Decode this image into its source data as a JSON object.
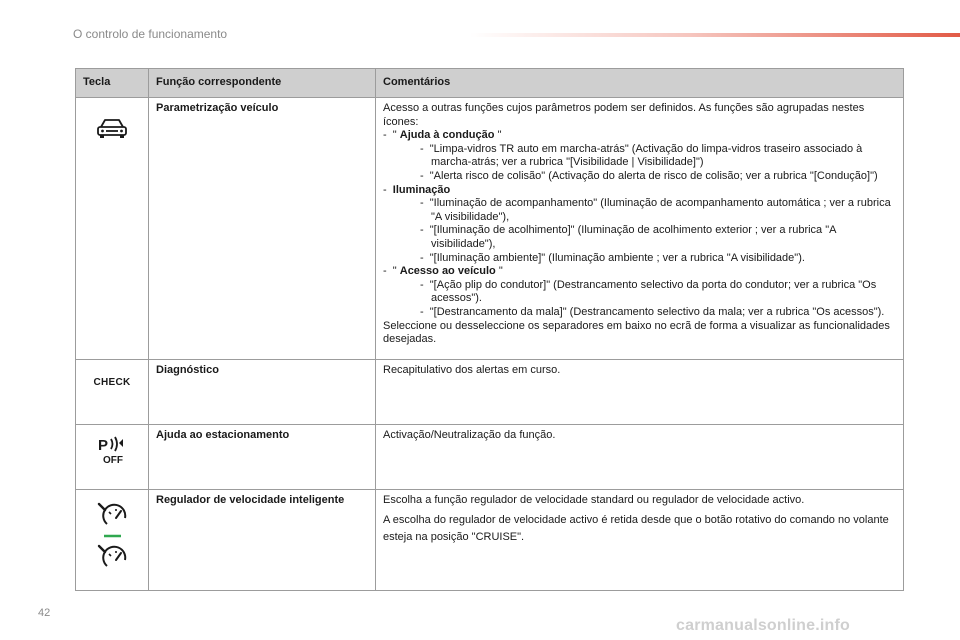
{
  "header": {
    "title": "O controlo de funcionamento"
  },
  "table": {
    "headers": {
      "key": "Tecla",
      "function": "Função correspondente",
      "comments": "Comentários"
    },
    "rows": {
      "vehicle": {
        "icon": "car-icon",
        "function": "Parametrização veículo",
        "intro": "Acesso a outras funções cujos parâmetros podem ser definidos. As funções são agrupadas nestes ícones:",
        "g1_prefix": "\"",
        "g1_title": "Ajuda à condução",
        "g1_suffix": "\"",
        "g1_items": [
          "\"Limpa-vidros TR auto em marcha-atrás\" (Activação do limpa-vidros traseiro associado à marcha-atrás; ver a rubrica \"[Visibilidade | Visibilidade]\")",
          "\"Alerta risco de colisão\" (Activação do alerta de risco de colisão; ver a rubrica \"[Condução]\")"
        ],
        "g2_title": "Iluminação",
        "g2_items": [
          "\"Iluminação de acompanhamento\" (Iluminação de acompanhamento automática ; ver a rubrica \"A visibilidade\"),",
          "\"[Iluminação de acolhimento]\" (Iluminação de acolhimento exterior ; ver a rubrica \"A visibilidade\"),",
          "\"[Iluminação ambiente]\" (Iluminação ambiente ; ver a rubrica \"A visibilidade\")."
        ],
        "g3_prefix": "\"",
        "g3_title": "Acesso ao veículo",
        "g3_suffix": "\"",
        "g3_items": [
          "\"[Ação plip do condutor]\" (Destrancamento selectivo da porta do condutor; ver a rubrica \"Os acessos\").",
          "\"[Destrancamento da mala]\" (Destrancamento selectivo da mala; ver a rubrica \"Os acessos\")."
        ],
        "outro": "Seleccione ou desseleccione os separadores em baixo no ecrã de forma a visualizar as funcionalidades desejadas."
      },
      "diagnostic": {
        "icon_text": "CHECK",
        "function": "Diagnóstico",
        "comment": "Recapitulativo dos alertas em curso."
      },
      "parking": {
        "icon": "park-assist-off-icon",
        "icon_letter": "P",
        "icon_off": "OFF",
        "function": "Ajuda ao estacionamento",
        "comment": "Activação/Neutralização da função."
      },
      "cruise": {
        "icon": "speed-regulator-icon",
        "function": "Regulador de velocidade inteligente",
        "comment1": "Escolha a função regulador de velocidade standard ou regulador de velocidade activo.",
        "comment2": "A escolha do regulador de velocidade activo é retida desde que o botão rotativo do comando no volante esteja na posição \"CRUISE\"."
      }
    }
  },
  "footer": {
    "page_number": "42",
    "watermark": "carmanualsonline.info"
  },
  "colors": {
    "accent": "#e25a46",
    "header_bg": "#cfcfcf",
    "border": "#9c9c9c",
    "green": "#2fa84f"
  }
}
